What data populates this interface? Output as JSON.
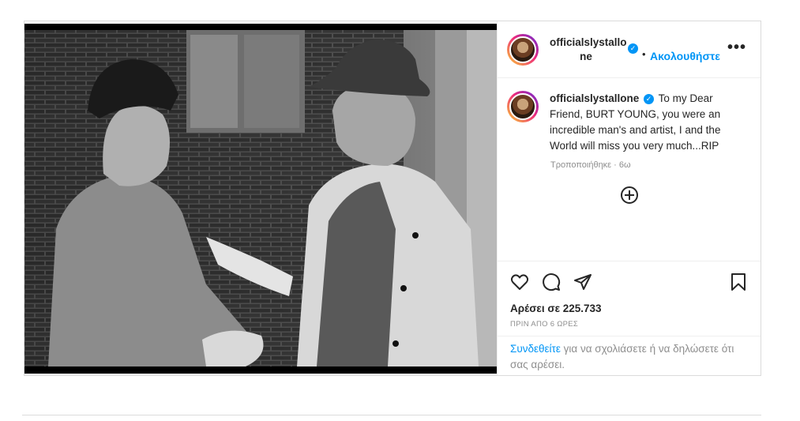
{
  "post": {
    "username": "officialslystallone",
    "username_wrapped": "officialslystallo ne",
    "header_separator": "•",
    "follow_label": "Ακολουθήστε",
    "more_label": "•••",
    "verified_mark": "✓",
    "caption": "To my Dear Friend, BURT YOUNG, you were an incredible man's and artist, I and the World will miss you very much...RIP",
    "caption_meta": "Τροποποιήθηκε · 6ω",
    "likes": "Αρέσει σε 225.733",
    "timestamp": "ΠΡΙΝ ΑΠΟ 6 ΩΡΕΣ",
    "login_link": "Συνδεθείτε",
    "login_text": " για να σχολιάσετε ή να δηλώσετε ότι σας αρέσει."
  },
  "icons": {
    "like": "heart-icon",
    "comment": "comment-icon",
    "share": "share-icon",
    "save": "bookmark-icon",
    "add": "plus-circle-icon",
    "more": "more-options-icon"
  },
  "colors": {
    "accent": "#0095f6",
    "text": "#262626",
    "muted": "#8e8e8e",
    "border": "#dbdbdb"
  }
}
